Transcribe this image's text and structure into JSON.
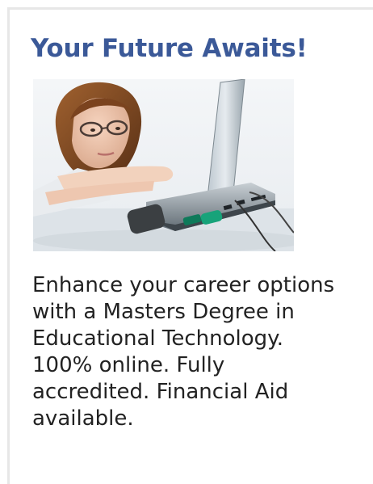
{
  "ad": {
    "headline": "Your Future Awaits!",
    "body": "Enhance your career options\nwith a Masters Degree in\nEducational Technology.\n100% online. Fully\naccredited. Financial Aid\navailable.",
    "image_subject": "woman-resting-on-laptop-photo"
  },
  "colors": {
    "headline": "#3b5998",
    "body_text": "#222222",
    "border": "#e7e7e7",
    "background": "#ffffff"
  }
}
